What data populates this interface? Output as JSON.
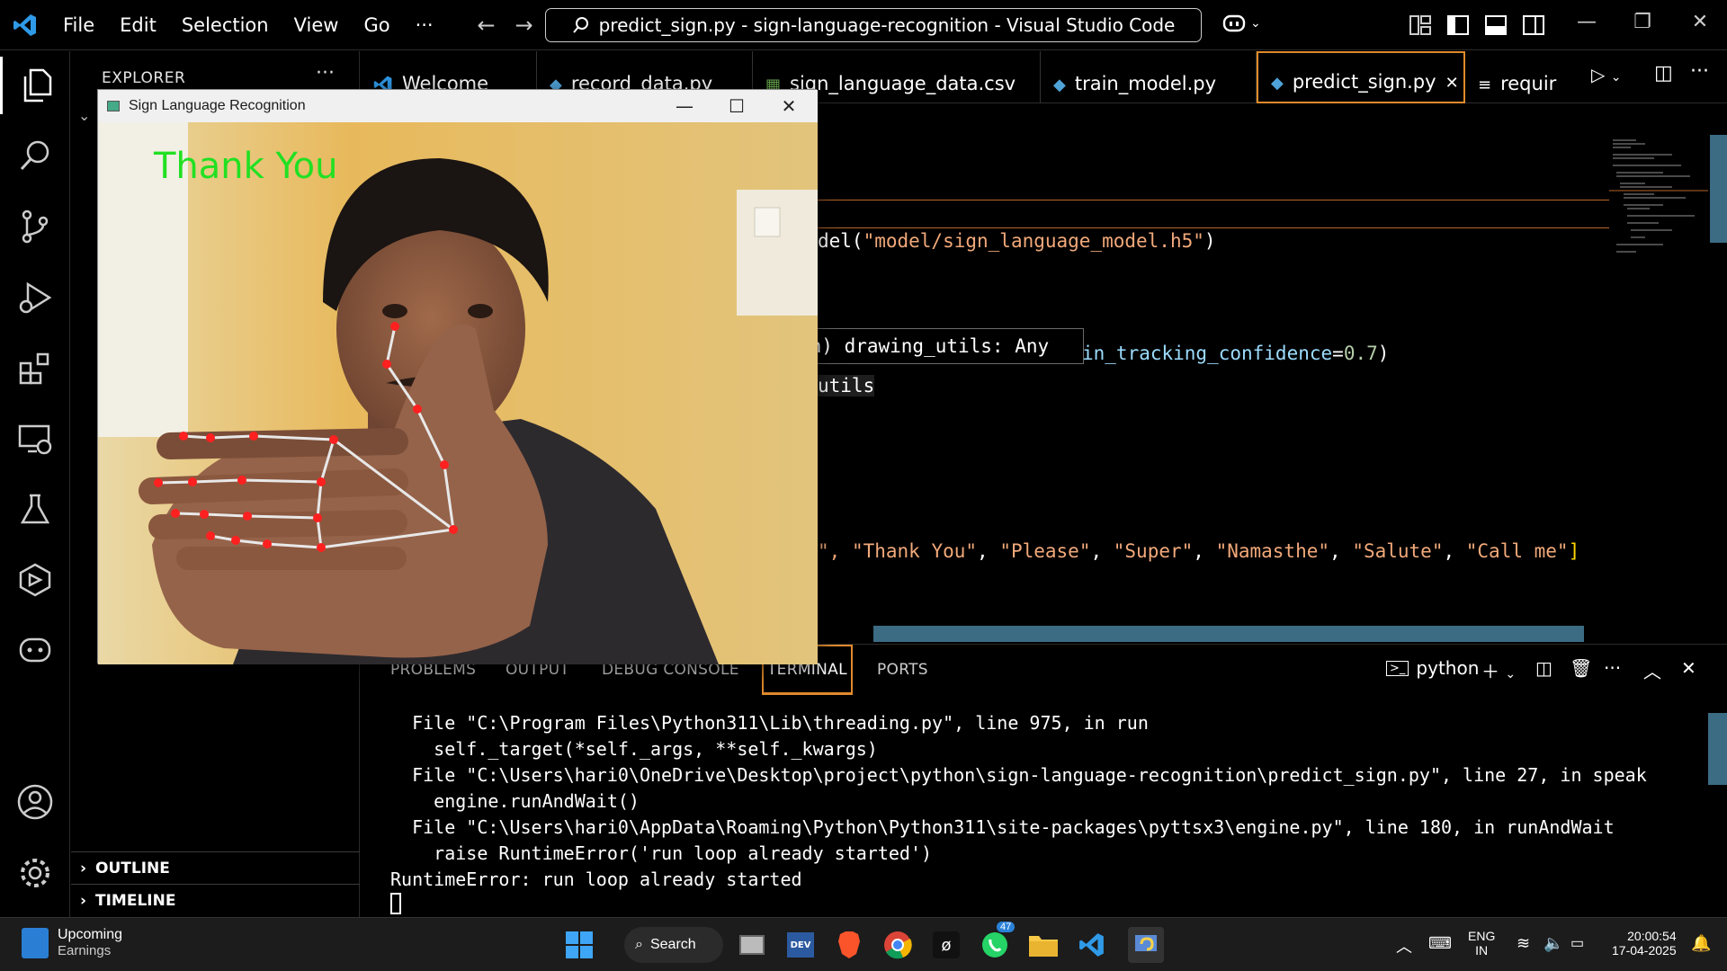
{
  "titlebar": {
    "menu": [
      "File",
      "Edit",
      "Selection",
      "View",
      "Go",
      "···"
    ],
    "command_center": "predict_sign.py - sign-language-recognition - Visual Studio Code"
  },
  "sidebar": {
    "title": "EXPLORER",
    "more": "···",
    "sections": [
      "OUTLINE",
      "TIMELINE"
    ]
  },
  "tabs": [
    {
      "label": "Welcome",
      "icon": "vscode-icon"
    },
    {
      "label": "record_data.py",
      "icon": "python-icon"
    },
    {
      "label": "sign_language_data.csv",
      "icon": "csv-icon"
    },
    {
      "label": "train_model.py",
      "icon": "python-icon"
    },
    {
      "label": "predict_sign.py",
      "icon": "python-icon",
      "active": true
    },
    {
      "label": "requir",
      "icon": "list-icon"
    }
  ],
  "editor": {
    "line_model_a": "del(",
    "line_model_b": "\"model/sign_language_model.h5\"",
    "line_model_c": ")",
    "hover_tip": "on) drawing_utils: Any",
    "line_conf_a": "in_tracking_confidence",
    "line_conf_b": "=",
    "line_conf_c": "0.7",
    "line_conf_d": ")",
    "line_utils": "utils",
    "labels_lead": "\", ",
    "labels": [
      "\"Thank You\"",
      "\"Please\"",
      "\"Super\"",
      "\"Namasthe\"",
      "\"Salute\"",
      "\"Call me\""
    ],
    "labels_close": "]"
  },
  "panel": {
    "tabs": [
      "PROBLEMS",
      "OUTPUT",
      "DEBUG CONSOLE",
      "TERMINAL",
      "PORTS"
    ],
    "active_tab": "TERMINAL",
    "shell": "python",
    "terminal_lines": [
      "  File \"C:\\Program Files\\Python311\\Lib\\threading.py\", line 975, in run",
      "    self._target(*self._args, **self._kwargs)",
      "  File \"C:\\Users\\hari0\\OneDrive\\Desktop\\project\\python\\sign-language-recognition\\predict_sign.py\", line 27, in speak",
      "    engine.runAndWait()",
      "  File \"C:\\Users\\hari0\\AppData\\Roaming\\Python\\Python311\\site-packages\\pyttsx3\\engine.py\", line 180, in runAndWait",
      "    raise RuntimeError('run loop already started')",
      "RuntimeError: run loop already started"
    ]
  },
  "camera_window": {
    "title": "Sign Language Recognition",
    "prediction": "Thank You",
    "prediction_color": "#22e022"
  },
  "taskbar": {
    "widget_title": "Upcoming",
    "widget_sub": "Earnings",
    "search": "Search",
    "whatsapp_badge": "47",
    "lang_top": "ENG",
    "lang_bottom": "IN",
    "time": "20:00:54",
    "date": "17-04-2025"
  },
  "colors": {
    "accent_tab_border": "#e08a2b",
    "string": "#f2a97a",
    "scrollbar": "#3c6b84"
  }
}
